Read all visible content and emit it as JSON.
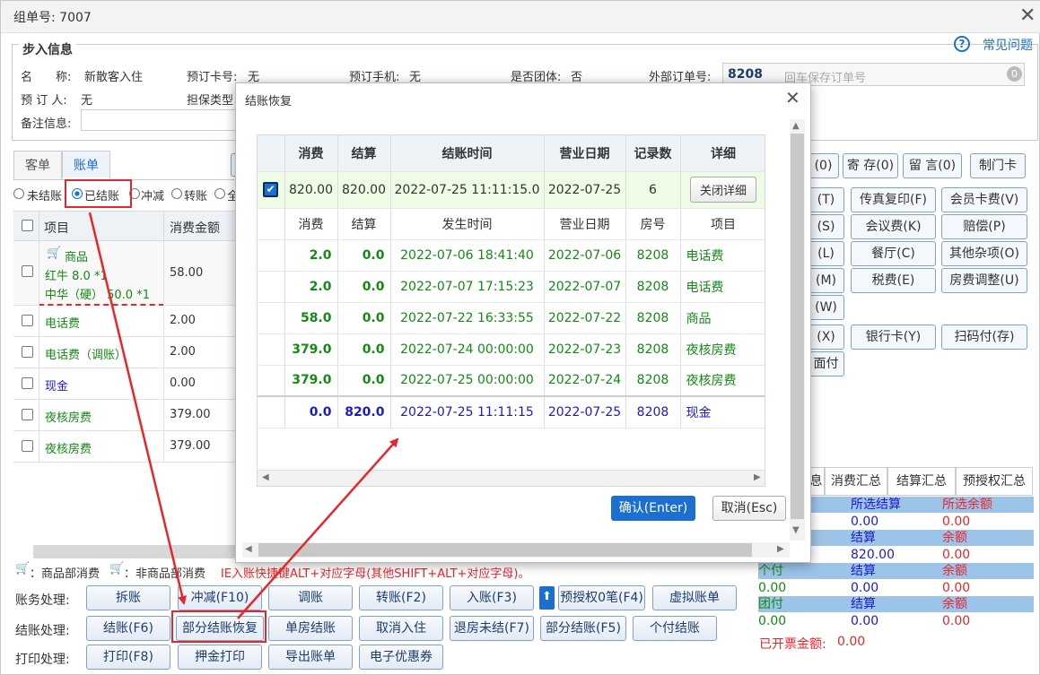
{
  "window": {
    "title": "组单号: 7007"
  },
  "help": {
    "label": "常见问题"
  },
  "checkin": {
    "legend": "步入信息",
    "name_label": "名　　称:",
    "name_value": "新散客入住",
    "booking_card_label": "预订卡号:",
    "booking_card_value": "无",
    "booking_phone_label": "预订手机:",
    "booking_phone_value": "无",
    "group_label": "是否团体:",
    "group_value": "否",
    "external_order_label": "外部订单号:",
    "room_no": "8208",
    "room_placeholder": "回车保存订单号",
    "booker_label": "预 订 人:",
    "booker_value": "无",
    "guarantee_label": "担保类型",
    "remark_label": "备注信息:"
  },
  "left_tabs": [
    "客单",
    "账单"
  ],
  "filters": [
    "未结账",
    "已结账",
    "冲减",
    "转账",
    "全"
  ],
  "bill_table": {
    "headers": [
      "项目",
      "消费金额"
    ],
    "rows": [
      {
        "item": "商品",
        "sub1": "红牛 8.0 *1",
        "sub2": "中华（硬） 50.0 *1",
        "amount": "58.00"
      },
      {
        "item": "电话费",
        "amount": "2.00"
      },
      {
        "item": "电话费（调账）",
        "amount": "2.00"
      },
      {
        "item": "现金",
        "amount": "0.00"
      },
      {
        "item": "夜核房费",
        "amount": "379.00"
      },
      {
        "item": "夜核房费",
        "amount": "379.00"
      }
    ]
  },
  "right_buttons": [
    [
      "(0)",
      "寄 存(0)",
      "留 言(0)",
      "制门卡"
    ],
    [
      "(T)",
      "传真复印(F)",
      "会员卡费(V)"
    ],
    [
      "(S)",
      "会议费(K)",
      "赔偿(P)"
    ],
    [
      "(L)",
      "餐厅(C)",
      "其他杂项(O)"
    ],
    [
      "(M)",
      "税费(E)",
      "房费调整(U)"
    ],
    [
      "(W)"
    ],
    [
      "(X)",
      "银行卡(Y)",
      "扫码付(存)"
    ],
    [
      "面付"
    ]
  ],
  "summary": {
    "tabs": [
      "息",
      "消费汇总",
      "结算汇总",
      "预授权汇总"
    ],
    "rows": [
      {
        "a": "",
        "b": "所选结算",
        "c": "所选余额"
      },
      {
        "a": "",
        "b": "0.00",
        "c": "0.00"
      },
      {
        "a": "",
        "b": "结算",
        "c": "余额"
      },
      {
        "a": "",
        "b": "820.00",
        "c": "0.00"
      },
      {
        "a": "个付",
        "b": "结算",
        "c": "余额"
      },
      {
        "a": "0.00",
        "b": "0.00",
        "c": "0.00"
      },
      {
        "a": "团付",
        "b": "结算",
        "c": "余额"
      },
      {
        "a": "0.00",
        "b": "0.00",
        "c": "0.00"
      }
    ],
    "invoice_label": "已开票金额:",
    "invoice_value": "0.00"
  },
  "legend_note": {
    "goods": "：商品部消费",
    "nongoods": "：非商品部消费",
    "hint": "IE入账快捷键ALT+对应字母(其他SHIFT+ALT+对应字母)。"
  },
  "actions": {
    "account_label": "账务处理:",
    "account": [
      "拆账",
      "冲减(F10)",
      "调账",
      "转账(F2)",
      "入账(F3)",
      "预授权0笔(F4)",
      "虚拟账单"
    ],
    "settle_label": "结账处理:",
    "settle": [
      "结账(F6)",
      "部分结账恢复",
      "单房结账",
      "取消入住",
      "退房未结(F7)",
      "部分结账(F5)",
      "个付结账"
    ],
    "print_label": "打印处理:",
    "print": [
      "打印(F8)",
      "押金打印",
      "导出账单",
      "电子优惠券"
    ]
  },
  "dialog": {
    "title": "结账恢复",
    "headers": [
      "消费",
      "结算",
      "结账时间",
      "营业日期",
      "记录数",
      "详细"
    ],
    "summary_row": {
      "consume": "820.00",
      "settle": "820.00",
      "time": "2022-07-25 11:11:15.0",
      "date": "2022-07-25",
      "count": "6",
      "detail_btn": "关闭详细"
    },
    "detail_headers": [
      "消费",
      "结算",
      "发生时间",
      "营业日期",
      "房号",
      "项目"
    ],
    "details": [
      {
        "c": "2.0",
        "s": "0.0",
        "t": "2022-07-06 18:41:40",
        "d": "2022-07-06",
        "r": "8208",
        "i": "电话费",
        "color": "green"
      },
      {
        "c": "2.0",
        "s": "0.0",
        "t": "2022-07-07 17:15:23",
        "d": "2022-07-07",
        "r": "8208",
        "i": "电话费",
        "color": "green"
      },
      {
        "c": "58.0",
        "s": "0.0",
        "t": "2022-07-22 16:33:55",
        "d": "2022-07-22",
        "r": "8208",
        "i": "商品",
        "color": "green"
      },
      {
        "c": "379.0",
        "s": "0.0",
        "t": "2022-07-24 00:00:00",
        "d": "2022-07-23",
        "r": "8208",
        "i": "夜核房费",
        "color": "green"
      },
      {
        "c": "379.0",
        "s": "0.0",
        "t": "2022-07-25 00:00:00",
        "d": "2022-07-24",
        "r": "8208",
        "i": "夜核房费",
        "color": "green"
      },
      {
        "c": "0.0",
        "s": "820.0",
        "t": "2022-07-25 11:11:15",
        "d": "2022-07-25",
        "r": "8208",
        "i": "现金",
        "color": "blue"
      }
    ],
    "ok_label": "确认(Enter)",
    "cancel_label": "取消(Esc)"
  },
  "colors": {
    "accent": "#1a6fd1",
    "annotation": "#e8262a",
    "green": "#138a13",
    "blue": "#1a1ad0"
  }
}
